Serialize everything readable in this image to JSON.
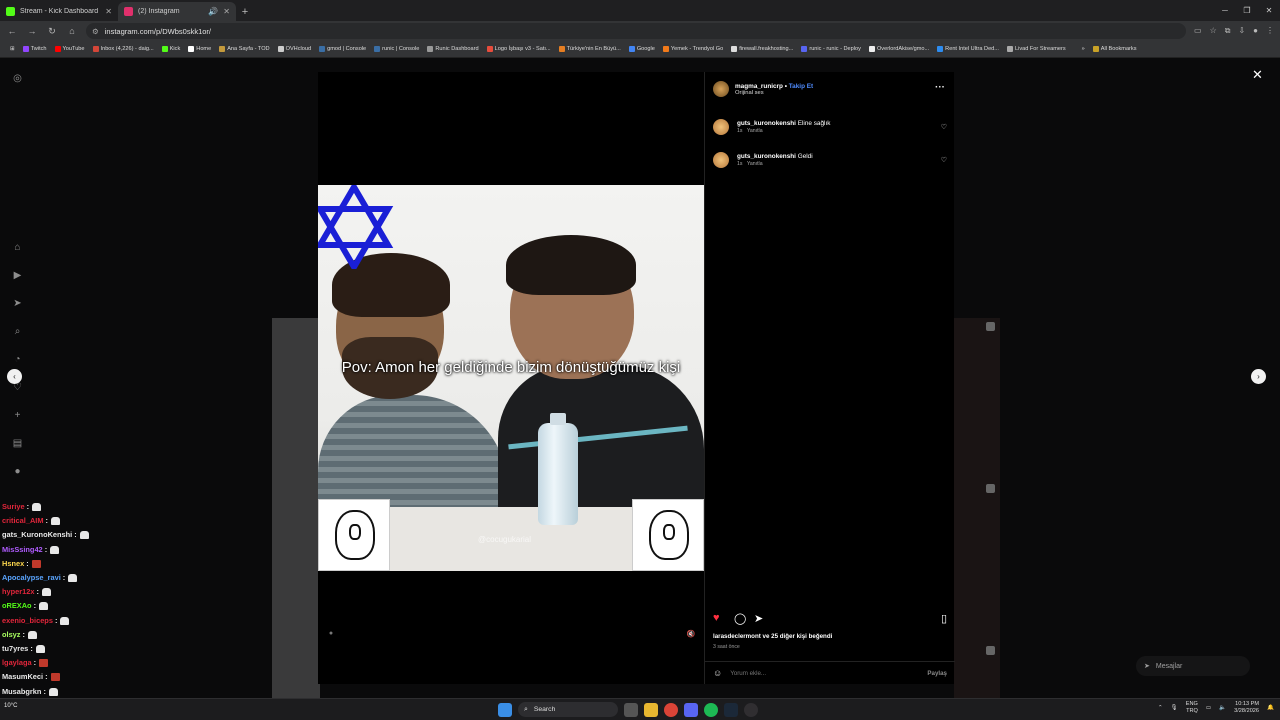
{
  "browser": {
    "tabs": [
      {
        "label": "Stream - Kick Dashboard",
        "color": "#53fc18"
      },
      {
        "label": "(2) Instagram",
        "color": "#e1306c"
      }
    ],
    "url": "instagram.com/p/DWbs0skk1or/",
    "bookmarks": [
      "Twitch",
      "YouTube",
      "Inbox (4,226) - daig...",
      "Kick",
      "Home",
      "Ana Sayfa - TOD",
      "OVHcloud",
      "gmod | Console",
      "runic | Console",
      "Runic Dashboard",
      "Logo İşbaşı v3 - Satı...",
      "Türkiye'nin En Büyü...",
      "Google",
      "Yemek - Trendyol Go",
      "firewall.freakhosting...",
      "runic - runic - Deploy",
      "OverlordAkise/gmo...",
      "Rent Intel Ultra Ded...",
      "Livad For Streamers"
    ],
    "all_bookmarks": "All Bookmarks"
  },
  "post": {
    "username": "magma_runicrp",
    "follow": "Takip Et",
    "audio": "Orijinal ses",
    "caption_text": "Pov: Amon her geldiğinde bizim dönüştüğümüz kişi",
    "watermark": "@cocugukarial",
    "comments": [
      {
        "user": "guts_kuronokenshi",
        "text": "Eline sağlık",
        "time": "1s",
        "reply": "Yanıtla"
      },
      {
        "user": "guts_kuronokenshi",
        "text": "Geldi",
        "time": "1s",
        "reply": "Yanıtla"
      }
    ],
    "likes_text": "larasdeclermont ve 25 diğer kişi beğendi",
    "posted_ago": "3 saat önce",
    "comment_placeholder": "Yorum ekle...",
    "share_label": "Paylaş",
    "liked": true
  },
  "messages_label": "Mesajlar",
  "chat": [
    {
      "user": "Suriye",
      "color": "#e2263b",
      "emote": "white"
    },
    {
      "user": "critical_AIM",
      "color": "#e2263b",
      "emote": "white"
    },
    {
      "user": "gats_KuronoKenshi",
      "color": "#e9e9e9",
      "emote": "white"
    },
    {
      "user": "MisSsing42",
      "color": "#b05cff",
      "emote": "white"
    },
    {
      "user": "Hsnex",
      "color": "#ffd84d",
      "emote": "red"
    },
    {
      "user": "Apocalypse_ravi",
      "color": "#5aa5ff",
      "emote": "white"
    },
    {
      "user": "hyper12x",
      "color": "#e2263b",
      "emote": "white"
    },
    {
      "user": "oREXAo",
      "color": "#53fc18",
      "emote": "white"
    },
    {
      "user": "exenio_biceps",
      "color": "#e2263b",
      "emote": "white"
    },
    {
      "user": "olsyz",
      "color": "#a8ff60",
      "emote": "white"
    },
    {
      "user": "tu7yres",
      "color": "#e9e9e9",
      "emote": "white"
    },
    {
      "user": "lgaylaga",
      "color": "#e2263b",
      "emote": "red"
    },
    {
      "user": "MasumKeci",
      "color": "#e9e9e9",
      "emote": "red"
    },
    {
      "user": "Musabgrkn",
      "color": "#e9e9e9",
      "emote": "white"
    },
    {
      "user": "MisSsing42",
      "color": "#b05cff",
      "emote": "red"
    }
  ],
  "taskbar": {
    "search_label": "Search",
    "lang": "ENG",
    "lang2": "TRQ",
    "time": "10:13 PM",
    "date": "3/28/2026",
    "weather": "10°C"
  }
}
